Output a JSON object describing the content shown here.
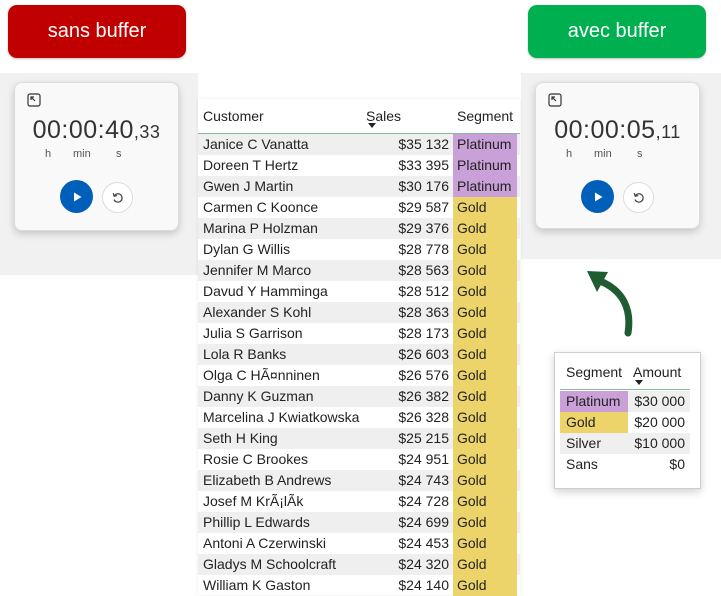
{
  "buttons": {
    "left_label": "sans buffer",
    "right_label": "avec buffer"
  },
  "colors": {
    "red_button": "#c00000",
    "green_button": "#00b050",
    "platinum": "#c9a0d8",
    "gold": "#ecd46b",
    "play_blue": "#005fb8",
    "arrow_green": "#1f5c32"
  },
  "timers": [
    {
      "main": "00:00:40",
      "centis": ",33",
      "unit_h": "h",
      "unit_min": "min",
      "unit_s": "s"
    },
    {
      "main": "00:00:05",
      "centis": ",11",
      "unit_h": "h",
      "unit_min": "min",
      "unit_s": "s"
    }
  ],
  "table": {
    "headers": {
      "customer": "Customer",
      "sales": "Sales",
      "segment": "Segment"
    },
    "rows": [
      {
        "name": "Janice C Vanatta",
        "sales": "$35 132",
        "segment": "Platinum"
      },
      {
        "name": "Doreen T Hertz",
        "sales": "$33 395",
        "segment": "Platinum"
      },
      {
        "name": "Gwen J Martin",
        "sales": "$30 176",
        "segment": "Platinum"
      },
      {
        "name": "Carmen C Koonce",
        "sales": "$29 587",
        "segment": "Gold"
      },
      {
        "name": "Marina P Holzman",
        "sales": "$29 376",
        "segment": "Gold"
      },
      {
        "name": "Dylan G Willis",
        "sales": "$28 778",
        "segment": "Gold"
      },
      {
        "name": "Jennifer M Marco",
        "sales": "$28 563",
        "segment": "Gold"
      },
      {
        "name": "Davud Y Hamminga",
        "sales": "$28 512",
        "segment": "Gold"
      },
      {
        "name": "Alexander S Kohl",
        "sales": "$28 363",
        "segment": "Gold"
      },
      {
        "name": "Julia S Garrison",
        "sales": "$28 173",
        "segment": "Gold"
      },
      {
        "name": "Lola R Banks",
        "sales": "$26 603",
        "segment": "Gold"
      },
      {
        "name": "Olga C HÃ¤nninen",
        "sales": "$26 576",
        "segment": "Gold"
      },
      {
        "name": "Danny K Guzman",
        "sales": "$26 382",
        "segment": "Gold"
      },
      {
        "name": "Marcelina J Kwiatkowska",
        "sales": "$26 328",
        "segment": "Gold"
      },
      {
        "name": "Seth H King",
        "sales": "$25 215",
        "segment": "Gold"
      },
      {
        "name": "Rosie C Brookes",
        "sales": "$24 951",
        "segment": "Gold"
      },
      {
        "name": "Elizabeth B Andrews",
        "sales": "$24 743",
        "segment": "Gold"
      },
      {
        "name": "Josef M KrÃ¡lÃ­k",
        "sales": "$24 728",
        "segment": "Gold"
      },
      {
        "name": "Phillip L Edwards",
        "sales": "$24 699",
        "segment": "Gold"
      },
      {
        "name": "Antoni A Czerwinski",
        "sales": "$24 453",
        "segment": "Gold"
      },
      {
        "name": "Gladys M Schoolcraft",
        "sales": "$24 320",
        "segment": "Gold"
      },
      {
        "name": "William K Gaston",
        "sales": "$24 140",
        "segment": "Gold"
      }
    ]
  },
  "legend": {
    "headers": {
      "segment": "Segment",
      "amount": "Amount"
    },
    "rows": [
      {
        "segment": "Platinum",
        "amount": "$30 000"
      },
      {
        "segment": "Gold",
        "amount": "$20 000"
      },
      {
        "segment": "Silver",
        "amount": "$10 000"
      },
      {
        "segment": "Sans",
        "amount": "$0"
      }
    ]
  }
}
